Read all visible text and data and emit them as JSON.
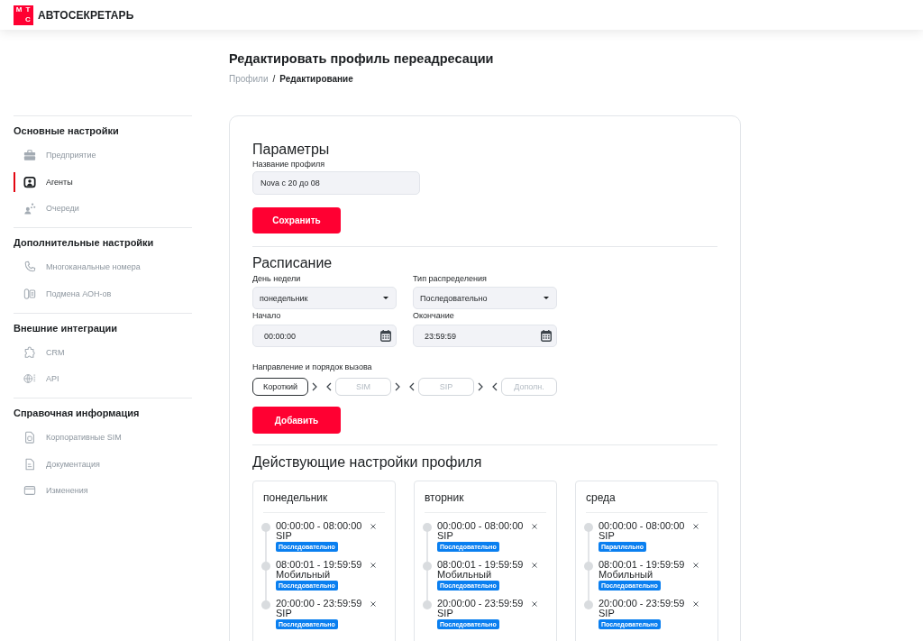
{
  "header": {
    "logo_letters": [
      "М",
      "Т",
      "С"
    ],
    "product_name": "АВТОСЕКРЕТАРЬ"
  },
  "sidebar": {
    "sections": [
      {
        "title": "Основные настройки",
        "items": [
          {
            "label": "Предприятие",
            "selected": false
          },
          {
            "label": "Агенты",
            "selected": true
          },
          {
            "label": "Очереди",
            "selected": false
          }
        ]
      },
      {
        "title": "Дополнительные настройки",
        "items": [
          {
            "label": "Многоканальные номера",
            "selected": false
          },
          {
            "label": "Подмена АОН-ов",
            "selected": false
          }
        ]
      },
      {
        "title": "Внешние интеграции",
        "items": [
          {
            "label": "CRM",
            "selected": false
          },
          {
            "label": "API",
            "selected": false
          }
        ]
      },
      {
        "title": "Справочная информация",
        "items": [
          {
            "label": "Корпоративные SIM",
            "selected": false
          },
          {
            "label": "Документация",
            "selected": false
          },
          {
            "label": "Изменения",
            "selected": false
          }
        ]
      }
    ]
  },
  "page": {
    "title": "Редактировать профиль переадресации",
    "breadcrumbs": [
      {
        "label": "Профили",
        "current": false
      },
      {
        "label": "Редактирование",
        "current": true
      }
    ],
    "breadcrumb_separator": "/"
  },
  "parameters": {
    "title": "Параметры",
    "profile_name": {
      "label": "Название профиля",
      "value": "Nova с 20 до 08"
    },
    "save_button": "Сохранить"
  },
  "schedule": {
    "title": "Расписание",
    "fields": [
      {
        "label": "День недели",
        "value": "понедельник",
        "kind": "select"
      },
      {
        "label": "Тип распределения",
        "value": "Последовательно",
        "kind": "select"
      },
      {
        "label": "Начало",
        "value": "00:00:00",
        "kind": "time"
      },
      {
        "label": "Окончание",
        "value": "23:59:59",
        "kind": "time"
      }
    ],
    "route": {
      "label": "Направление и порядок вызова",
      "slots": [
        {
          "value": "Короткий"
        },
        {
          "placeholder": "SIM"
        },
        {
          "placeholder": "SIP"
        },
        {
          "placeholder": "Дополн."
        }
      ]
    },
    "add_button": "Добавить"
  },
  "active_settings": {
    "title": "Действующие настройки профиля",
    "days": [
      {
        "day": "понедельник",
        "entries": [
          {
            "time": "00:00:00 - 08:00:00",
            "direction": "SIP",
            "mode": "Последовательно"
          },
          {
            "time": "08:00:01 - 19:59:59",
            "direction": "Мобильный",
            "mode": "Последовательно"
          },
          {
            "time": "20:00:00 - 23:59:59",
            "direction": "SIP",
            "mode": "Последовательно"
          }
        ]
      },
      {
        "day": "вторник",
        "entries": [
          {
            "time": "00:00:00 - 08:00:00",
            "direction": "SIP",
            "mode": "Последовательно"
          },
          {
            "time": "08:00:01 - 19:59:59",
            "direction": "Мобильный",
            "mode": "Последовательно"
          },
          {
            "time": "20:00:00 - 23:59:59",
            "direction": "SIP",
            "mode": "Последовательно"
          }
        ]
      },
      {
        "day": "среда",
        "entries": [
          {
            "time": "00:00:00 - 08:00:00",
            "direction": "SIP",
            "mode": "Параллельно"
          },
          {
            "time": "08:00:01 - 19:59:59",
            "direction": "Мобильный",
            "mode": "Последовательно"
          },
          {
            "time": "20:00:00 - 23:59:59",
            "direction": "SIP",
            "mode": "Последовательно"
          }
        ]
      }
    ]
  }
}
